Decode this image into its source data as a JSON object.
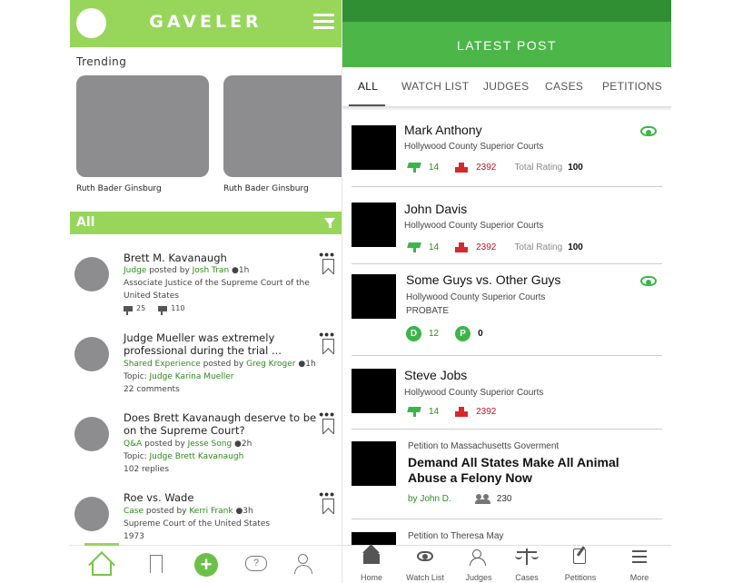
{
  "left": {
    "app_title": "GAVELER",
    "trending_label": "Trending",
    "trending": [
      {
        "name": "Ruth Bader Ginsburg"
      },
      {
        "name": "Ruth Bader Ginsburg"
      }
    ],
    "filter_label": "All",
    "posts": [
      {
        "title": "Brett M. Kavanaugh",
        "line1_green": "Judge",
        "line1_mid": " posted by ",
        "line1_user": "Josh Tran",
        "line1_time": " ●1h",
        "line2": "Associate Justice of the Supreme Court of the United States",
        "up": "25",
        "down": "110"
      },
      {
        "title": "Judge Mueller was extremely professional during the trial ...",
        "line1_green": "Shared Experience",
        "line1_mid": " posted by ",
        "line1_user": "Greg Kroger",
        "line1_time": " ●1h",
        "topic_label": "Topic: ",
        "topic_value": "Judge Karina Mueller",
        "count": "22 comments"
      },
      {
        "title": "Does Brett Kavanaugh deserve to be on the Supreme Court?",
        "line1_green": "Q&A",
        "line1_mid": " posted by ",
        "line1_user": "Jesse Song",
        "line1_time": " ●2h",
        "topic_label": "Topic: ",
        "topic_value": "Judge Brett Kavanaugh",
        "count": "102 replies"
      },
      {
        "title": "Roe vs. Wade",
        "line1_green": "Case",
        "line1_mid": " posted by ",
        "line1_user": "Kerri Frank",
        "line1_time": " ●3h",
        "line2": "Supreme Court of the United States",
        "line3": "1973"
      }
    ],
    "more_glyph": "•••",
    "plus_glyph": "+",
    "chat_glyph": "?"
  },
  "right": {
    "header_title": "LATEST POST",
    "tabs": [
      "ALL",
      "WATCH LIST",
      "JUDGES",
      "CASES",
      "PETITIONS"
    ],
    "cards": [
      {
        "name": "Mark Anthony",
        "court": "Hollywood County Superior Courts",
        "up": "14",
        "down": "2392",
        "rating_label": "Total Rating",
        "rating": "100"
      },
      {
        "name": "John Davis",
        "court": "Hollywood County Superior Courts",
        "up": "14",
        "down": "2392",
        "rating_label": "Total Rating",
        "rating": "100"
      },
      {
        "name": "Some Guys vs. Other Guys",
        "court": "Hollywood County Superior Courts",
        "type": "PROBATE",
        "d_label": "D",
        "d_count": "12",
        "p_label": "P",
        "p_count": "0"
      },
      {
        "name": "Steve Jobs",
        "court": "Hollywood County Superior Courts",
        "up": "14",
        "down": "2392"
      },
      {
        "kicker": "Petition to Massachusetts Goverment",
        "title": "Demand All States Make All Animal Abuse a Felony Now",
        "by": "by John D.",
        "supporters": "230"
      },
      {
        "kicker": "Petition to Theresa May"
      }
    ],
    "bottom_tabs": [
      "Home",
      "Watch List",
      "Judges",
      "Cases",
      "Petitions",
      "More"
    ]
  },
  "colors": {
    "left_green": "#97d65b",
    "right_green": "#4cb649",
    "right_status_green": "#2f8f32",
    "upvote_green": "#3bb54a",
    "downvote_red": "#d7282f"
  },
  "icons": [
    "home-icon",
    "bookmark-icon",
    "add-icon",
    "chat-question-icon",
    "judge-scale-icon",
    "eye-icon",
    "gavel-up-icon",
    "gavel-down-icon",
    "filter-icon",
    "menu-icon",
    "people-icon"
  ]
}
